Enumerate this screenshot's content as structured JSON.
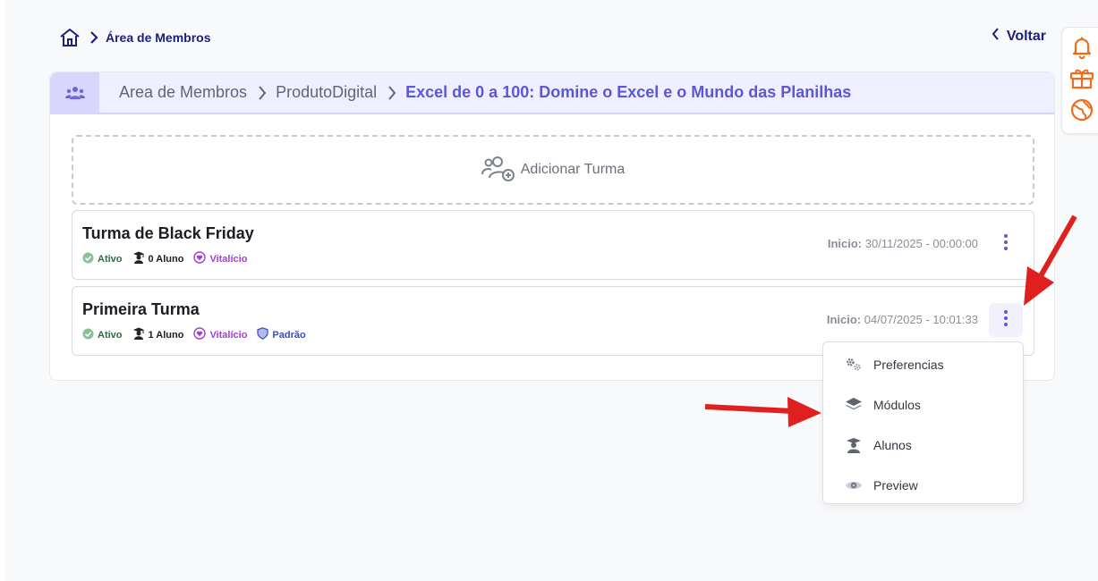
{
  "topbar": {
    "breadcrumb": "Área de Membros",
    "back_label": "Voltar"
  },
  "header": {
    "crumbs": [
      "Area de Membros",
      "ProdutoDigital"
    ],
    "current": "Excel de 0 a 100: Domine o Excel e o Mundo das Planilhas"
  },
  "add_turma": {
    "label": "Adicionar Turma"
  },
  "turmas": [
    {
      "title": "Turma de Black Friday",
      "status": "Ativo",
      "alunos": "0 Aluno",
      "access": "Vitalício",
      "start_label": "Inicio:",
      "start_value": "30/11/2025 - 00:00:00"
    },
    {
      "title": "Primeira Turma",
      "status": "Ativo",
      "alunos": "1 Aluno",
      "access": "Vitalício",
      "default_tag": "Padrão",
      "start_label": "Inicio:",
      "start_value": "04/07/2025 - 10:01:33"
    }
  ],
  "menu": {
    "items": [
      {
        "label": "Preferencias",
        "icon": "gears-icon"
      },
      {
        "label": "Módulos",
        "icon": "layers-icon"
      },
      {
        "label": "Alunos",
        "icon": "graduate-icon"
      },
      {
        "label": "Preview",
        "icon": "eye-icon"
      }
    ]
  },
  "colors": {
    "brand_dark": "#1b1f7a",
    "accent": "#5b57d6",
    "orange": "#ef6c1a",
    "annotation_red": "#e0201f"
  }
}
